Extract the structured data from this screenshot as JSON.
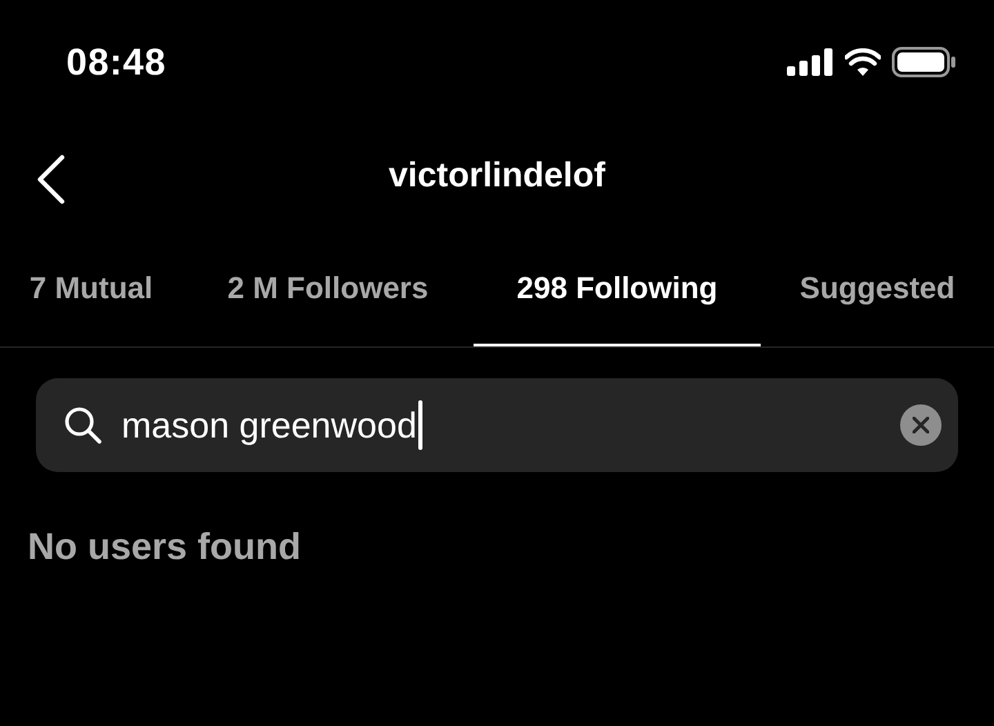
{
  "status_bar": {
    "time": "08:48"
  },
  "header": {
    "title": "victorlindelof"
  },
  "tabs": [
    {
      "label": "7 Mutual",
      "selected": false
    },
    {
      "label": "2 M Followers",
      "selected": false
    },
    {
      "label": "298 Following",
      "selected": true
    },
    {
      "label": "Suggested",
      "selected": false
    }
  ],
  "search": {
    "value": "mason greenwood",
    "focused": true
  },
  "empty_message": "No users found"
}
